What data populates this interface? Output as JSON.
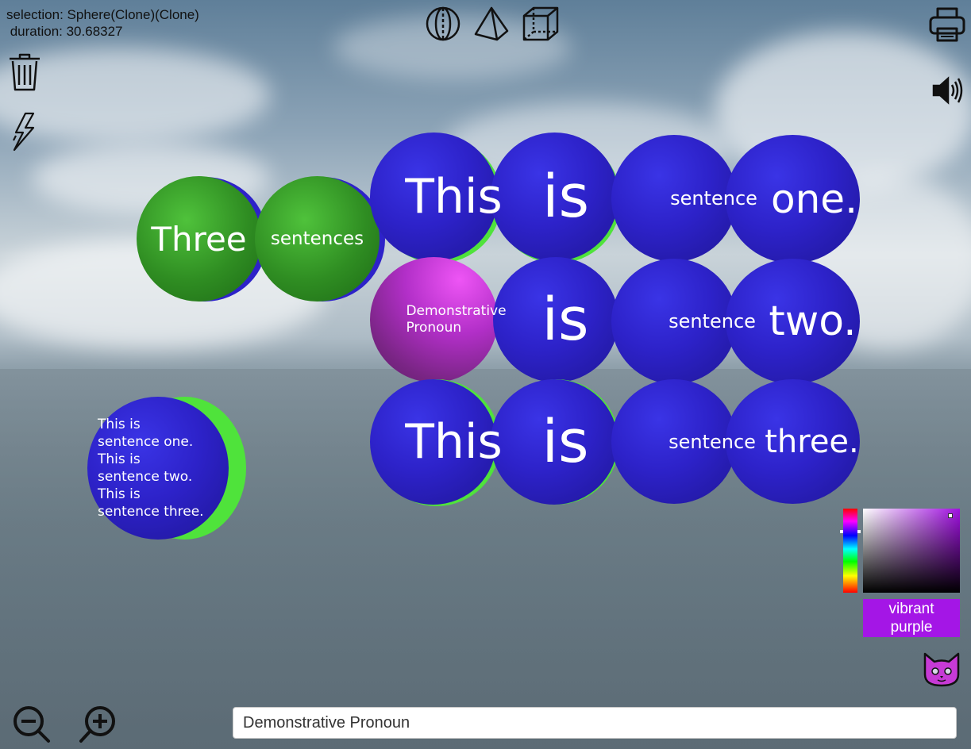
{
  "hud": {
    "selection": "selection: Sphere(Clone)(Clone)",
    "duration": " duration: 30.68327"
  },
  "toolbar": {
    "icons": [
      "sphere-icon",
      "pyramid-icon",
      "cube-icon",
      "printer-icon",
      "trash-icon",
      "lightning-icon",
      "speaker-icon",
      "zoom-out-icon",
      "zoom-in-icon",
      "cat-icon"
    ]
  },
  "spheres": {
    "three": "Three",
    "sentences": "sentences",
    "row1": [
      "This",
      "is",
      "sentence",
      "one."
    ],
    "row2": [
      "Demonstrative\nPronoun",
      "is",
      "sentence",
      "two."
    ],
    "row3": [
      "This",
      "is",
      "sentence",
      "three."
    ],
    "summary": "This is\nsentence one.\nThis is\nsentence two.\nThis is\nsentence three."
  },
  "color_picker": {
    "label": "vibrant\npurple",
    "color": "#a416e6"
  },
  "search": {
    "value": "Demonstrative Pronoun"
  },
  "colors": {
    "blue_sphere": "#2d22c9",
    "green_sphere": "#2f8d22",
    "purple_sphere": "#b22fc8"
  }
}
